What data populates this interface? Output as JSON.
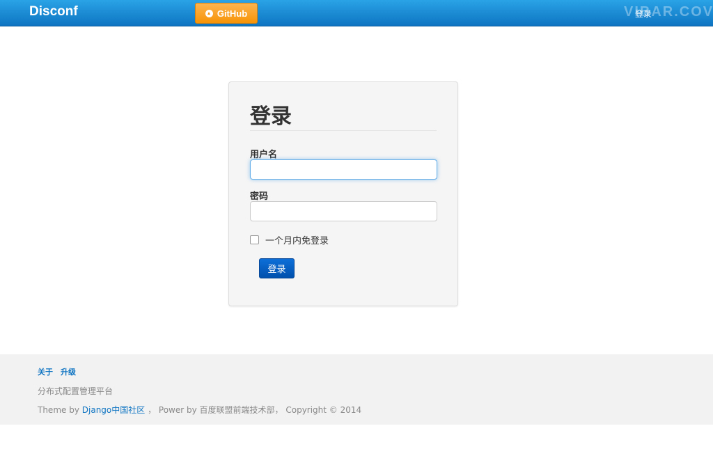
{
  "navbar": {
    "brand": "Disconf",
    "github_label": "GitHub",
    "login_link": "登录",
    "watermark": "VIBAR.COV"
  },
  "login_form": {
    "title": "登录",
    "username_label": "用户名",
    "username_value": "",
    "password_label": "密码",
    "password_value": "",
    "remember_label": "一个月内免登录",
    "remember_checked": false,
    "submit_label": "登录"
  },
  "footer": {
    "links": [
      "关于",
      "升级"
    ],
    "description": "分布式配置管理平台",
    "theme_prefix": "Theme by",
    "theme_link": "Django中国社区",
    "credits_suffix": "，  Power by 百度联盟前端技术部，  Copyright © 2014"
  },
  "colors": {
    "navbar": "#1a8ad6",
    "accent": "#0e74c2",
    "github_button": "#f89406",
    "submit_button": "#0150ad"
  }
}
